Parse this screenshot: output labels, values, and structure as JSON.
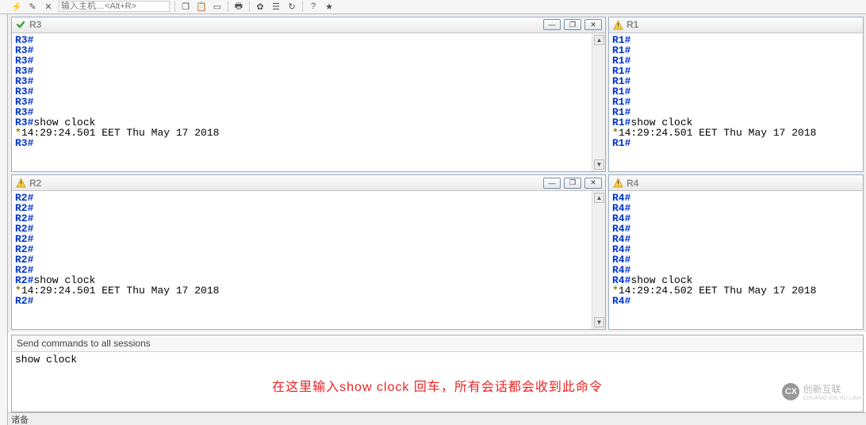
{
  "toolbar": {
    "address_placeholder": "输入主机…<Alt+R>"
  },
  "panes": [
    {
      "title": "R3",
      "status": "ok",
      "lines": [
        {
          "p": "R3#",
          "t": ""
        },
        {
          "p": "R3#",
          "t": ""
        },
        {
          "p": "R3#",
          "t": ""
        },
        {
          "p": "R3#",
          "t": ""
        },
        {
          "p": "R3#",
          "t": ""
        },
        {
          "p": "R3#",
          "t": ""
        },
        {
          "p": "R3#",
          "t": ""
        },
        {
          "p": "R3#",
          "t": ""
        },
        {
          "p": "R3#",
          "t": "show clock"
        },
        {
          "p": "*",
          "t": "14:29:24.501 EET Thu May 17 2018"
        },
        {
          "p": "R3#",
          "t": ""
        }
      ],
      "has_window_buttons": true
    },
    {
      "title": "R1",
      "status": "warn",
      "lines": [
        {
          "p": "R1#",
          "t": ""
        },
        {
          "p": "R1#",
          "t": ""
        },
        {
          "p": "R1#",
          "t": ""
        },
        {
          "p": "R1#",
          "t": ""
        },
        {
          "p": "R1#",
          "t": ""
        },
        {
          "p": "R1#",
          "t": ""
        },
        {
          "p": "R1#",
          "t": ""
        },
        {
          "p": "R1#",
          "t": ""
        },
        {
          "p": "R1#",
          "t": "show clock"
        },
        {
          "p": "*",
          "t": "14:29:24.501 EET Thu May 17 2018"
        },
        {
          "p": "R1#",
          "t": ""
        }
      ],
      "has_window_buttons": false
    },
    {
      "title": "R2",
      "status": "warn",
      "lines": [
        {
          "p": "R2#",
          "t": ""
        },
        {
          "p": "R2#",
          "t": ""
        },
        {
          "p": "R2#",
          "t": ""
        },
        {
          "p": "R2#",
          "t": ""
        },
        {
          "p": "R2#",
          "t": ""
        },
        {
          "p": "R2#",
          "t": ""
        },
        {
          "p": "R2#",
          "t": ""
        },
        {
          "p": "R2#",
          "t": ""
        },
        {
          "p": "R2#",
          "t": "show clock"
        },
        {
          "p": "*",
          "t": "14:29:24.501 EET Thu May 17 2018"
        },
        {
          "p": "R2#",
          "t": ""
        }
      ],
      "has_window_buttons": true
    },
    {
      "title": "R4",
      "status": "warn",
      "lines": [
        {
          "p": "R4#",
          "t": ""
        },
        {
          "p": "R4#",
          "t": ""
        },
        {
          "p": "R4#",
          "t": ""
        },
        {
          "p": "R4#",
          "t": ""
        },
        {
          "p": "R4#",
          "t": ""
        },
        {
          "p": "R4#",
          "t": ""
        },
        {
          "p": "R4#",
          "t": ""
        },
        {
          "p": "R4#",
          "t": ""
        },
        {
          "p": "R4#",
          "t": "show clock"
        },
        {
          "p": "*",
          "t": "14:29:24.502 EET Thu May 17 2018"
        },
        {
          "p": "R4#",
          "t": ""
        }
      ],
      "has_window_buttons": false
    }
  ],
  "sendall": {
    "label": "Send commands to all sessions",
    "value": "show clock"
  },
  "annotation": "在这里输入show clock 回车，所有会话都会收到此命令",
  "statusbar": "诸备",
  "watermark": {
    "brand": "创新互联",
    "sub": "CHUANG XIN HU LIAN",
    "logo": "CX"
  }
}
